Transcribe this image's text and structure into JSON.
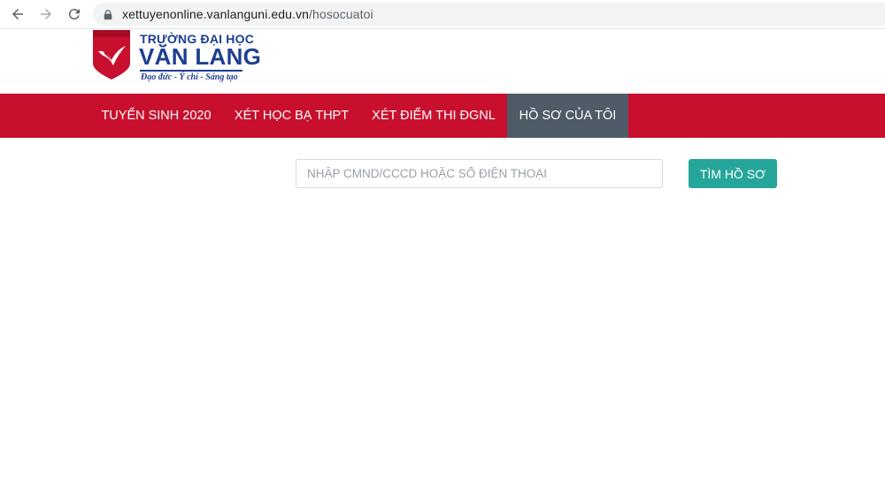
{
  "browser": {
    "url_host": "xettuyenonline.vanlanguni.edu.vn",
    "url_path": "/hosocuatoi",
    "back_icon": "arrow-left-icon",
    "forward_icon": "arrow-right-icon",
    "reload_icon": "reload-icon",
    "lock_icon": "lock-icon"
  },
  "header": {
    "logo_top": "TRƯỜNG ĐẠI HỌC",
    "logo_main": "VĂN LANG",
    "logo_slogan": "Đạo đức - Ý chí - Sáng tạo",
    "brand_red": "#c8102e",
    "brand_blue": "#1e3f8f"
  },
  "navbar": {
    "items": [
      {
        "label": "TUYỂN SINH 2020"
      },
      {
        "label": "XÉT HỌC BẠ THPT"
      },
      {
        "label": "XÉT ĐIỂM THI ĐGNL"
      },
      {
        "label": "HỒ SƠ CỦA TÔI"
      }
    ],
    "active_index": 3,
    "active_color": "#4f5b66"
  },
  "search": {
    "placeholder": "NHẬP CMND/CCCD HOẶC SỐ ĐIỆN THOẠI",
    "value": "",
    "button_label": "TÌM HỒ SƠ",
    "button_color": "#26a69a"
  }
}
